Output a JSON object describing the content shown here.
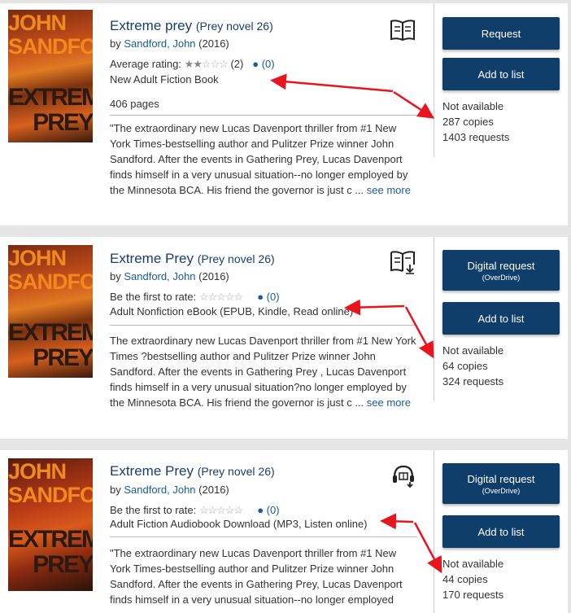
{
  "colors": {
    "accent": "#0f3e6b",
    "link": "#1a5a9a",
    "annotation_arrow": "#e8141e"
  },
  "cover": {
    "author": "JOHN SANDFORD",
    "title": "EXTREME PREY"
  },
  "results": [
    {
      "title": "Extreme prey",
      "series": "(Prey novel 26)",
      "by": "by",
      "author": "Sandford, John",
      "year": "(2016)",
      "rating_label": "Average rating:",
      "rating_stars": 2,
      "rating_count": "(2)",
      "comments": "(0)",
      "format": "New Adult Fiction Book",
      "pages": "406 pages",
      "description": "\"The extraordinary new Lucas Davenport thriller from #1 New York Times-bestselling author and Pulitzer Prize winner John Sandford. After the events in Gathering Prey, Lucas Davenport finds himself in a very unusual situation--no longer employed by the Minnesota BCA. His friend the governor is just c ...",
      "see_more": "see more",
      "primary_button": "Request",
      "primary_sub": "",
      "list_button": "Add to list",
      "availability": "Not available",
      "copies": "287 copies",
      "requests": "1403 requests",
      "format_icon": "book-icon"
    },
    {
      "title": "Extreme Prey",
      "series": "(Prey novel 26)",
      "by": "by",
      "author": "Sandford, John",
      "year": "(2016)",
      "rating_label": "Be the first to rate:",
      "rating_stars": 0,
      "rating_count": "",
      "comments": "(0)",
      "format": "Adult Nonfiction eBook (EPUB, Kindle, Read online)",
      "pages": "",
      "description": "The extraordinary new Lucas Davenport thriller from #1 New York Times ?bestselling author and Pulitzer Prize winner John Sandford. After the events in Gathering Prey , Lucas Davenport finds himself in a very unusual situation?no longer employed by the Minnesota BCA. His friend the governor is just c ...",
      "see_more": "see more",
      "primary_button": "Digital request",
      "primary_sub": "(OverDrive)",
      "list_button": "Add to list",
      "availability": "Not available",
      "copies": "64 copies",
      "requests": "324 requests",
      "format_icon": "ebook-download-icon"
    },
    {
      "title": "Extreme Prey",
      "series": "(Prey novel 26)",
      "by": "by",
      "author": "Sandford, John",
      "year": "(2016)",
      "rating_label": "Be the first to rate:",
      "rating_stars": 0,
      "rating_count": "",
      "comments": "(0)",
      "format": "Adult Fiction Audiobook Download (MP3, Listen online)",
      "pages": "",
      "description": "\"The extraordinary new Lucas Davenport thriller from #1 New York Times-bestselling author and Pulitzer Prize winner John Sandford. After the events in Gathering Prey, Lucas Davenport finds himself in a very unusual situation--no longer employed",
      "see_more": "",
      "primary_button": "Digital request",
      "primary_sub": "(OverDrive)",
      "list_button": "Add to list",
      "availability": "Not available",
      "copies": "44 copies",
      "requests": "170 requests",
      "format_icon": "audiobook-download-icon"
    }
  ]
}
